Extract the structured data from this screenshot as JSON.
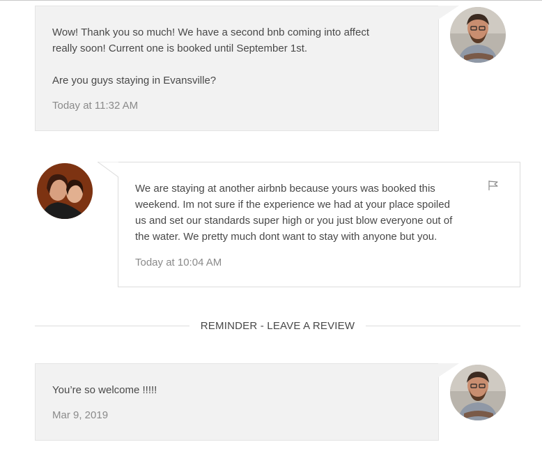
{
  "messages": [
    {
      "sender": "host",
      "text_line1": "Wow! Thank you so much! We have a second bnb coming into affect",
      "text_line2": "really soon! Current one is booked until September 1st.",
      "text_line3": "Are you guys staying in Evansville?",
      "timestamp": "Today at 11:32 AM"
    },
    {
      "sender": "guest",
      "text_line1": "We are staying at another airbnb because yours was booked this",
      "text_line2": "weekend. Im not sure if the experience we had at your place spoiled",
      "text_line3": "us and set our standards super high or you just blow everyone out of",
      "text_line4": "the water. We pretty much dont want to stay with anyone but you.",
      "timestamp": "Today at 10:04 AM"
    },
    {
      "sender": "host",
      "text_line1": "You’re so welcome !!!!!",
      "timestamp": "Mar 9, 2019"
    }
  ],
  "divider": {
    "label": "REMINDER - LEAVE A REVIEW"
  },
  "icons": {
    "report": "flag-icon",
    "host_avatar": "avatar",
    "guest_avatar": "avatar"
  },
  "colors": {
    "host_bubble": "#f2f2f2",
    "guest_bubble": "#ffffff",
    "timestamp": "#8a8a8a",
    "text": "#484848"
  }
}
